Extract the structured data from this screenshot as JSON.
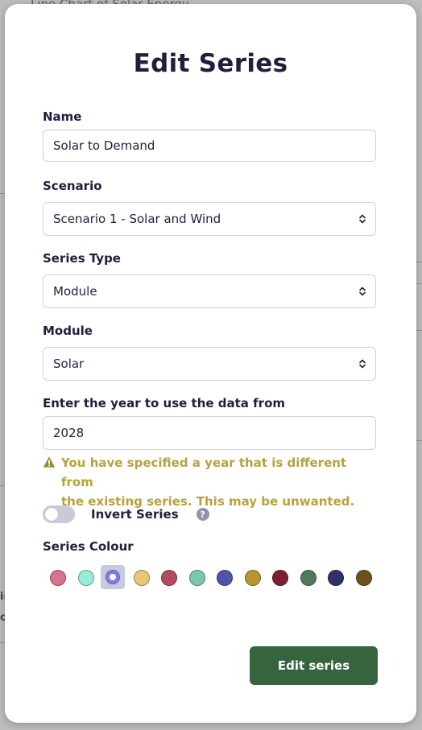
{
  "background": {
    "title_fragment": "Line Chart of Solar Energy",
    "fragments": [
      "ir",
      "ol"
    ]
  },
  "modal": {
    "title": "Edit Series",
    "name": {
      "label": "Name",
      "value": "Solar to Demand"
    },
    "scenario": {
      "label": "Scenario",
      "value": "Scenario 1 - Solar and Wind"
    },
    "series_type": {
      "label": "Series Type",
      "value": "Module"
    },
    "module": {
      "label": "Module",
      "value": "Solar"
    },
    "year": {
      "label": "Enter the year to use the data from",
      "value": "2028"
    },
    "warning": {
      "line1": "You have specified a year that is different from",
      "line2": "the existing series. This may be unwanted."
    },
    "invert": {
      "label": "Invert Series",
      "checked": false,
      "help_icon": "question-circle"
    },
    "colour": {
      "label": "Series Colour",
      "selected_index": 2,
      "options": [
        "#d9738d",
        "#99ecd7",
        "#7b7fe5",
        "#e9c773",
        "#b34b5e",
        "#7ac8ae",
        "#5054a9",
        "#b8962f",
        "#7a2030",
        "#4f7a5e",
        "#2e336b",
        "#6b521c"
      ]
    },
    "submit_label": "Edit series"
  },
  "colors": {
    "primary_text": "#1f1f3d",
    "warning_text": "#b5a33c",
    "button_green": "#35643f"
  }
}
